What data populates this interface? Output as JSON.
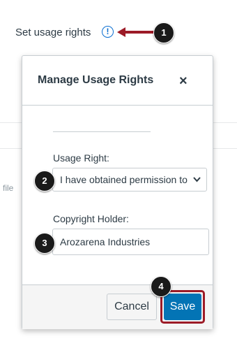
{
  "background": {
    "set_usage_rights": "Set usage rights",
    "warning_icon": "!",
    "file_fragment": "file"
  },
  "modal": {
    "title": "Manage Usage Rights",
    "close_icon": "×",
    "usage_right_label": "Usage Right:",
    "usage_right_value": "I have obtained permission to",
    "select_chevron": "⌄",
    "copyright_label": "Copyright Holder:",
    "copyright_value": "Arozarena Industries",
    "cancel_label": "Cancel",
    "save_label": "Save"
  },
  "steps": [
    "1",
    "2",
    "3",
    "4"
  ],
  "colors": {
    "primary": "#0374b5",
    "arrow": "#9c1b27",
    "step_bg": "#1a1a1a",
    "warning": "#0a6ed1"
  }
}
